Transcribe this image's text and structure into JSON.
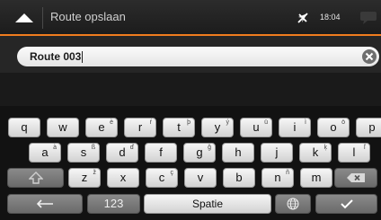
{
  "header": {
    "title": "Route opslaan",
    "time": "18:04",
    "back_icon": "chevron-up-icon",
    "gps_icon": "gps-off-icon",
    "message_icon": "message-bubble-icon"
  },
  "input": {
    "value": "Route 003",
    "clear_icon": "clear-icon"
  },
  "keyboard": {
    "row1": [
      {
        "key": "q",
        "alt": ""
      },
      {
        "key": "w",
        "alt": ""
      },
      {
        "key": "e",
        "alt": "è"
      },
      {
        "key": "r",
        "alt": "ŕ"
      },
      {
        "key": "t",
        "alt": "þ"
      },
      {
        "key": "y",
        "alt": "ý"
      },
      {
        "key": "u",
        "alt": "ü"
      },
      {
        "key": "i",
        "alt": "ì"
      },
      {
        "key": "o",
        "alt": "ö"
      },
      {
        "key": "p",
        "alt": ""
      }
    ],
    "row2": [
      {
        "key": "a",
        "alt": "à"
      },
      {
        "key": "s",
        "alt": "ß"
      },
      {
        "key": "d",
        "alt": "ď"
      },
      {
        "key": "f",
        "alt": ""
      },
      {
        "key": "g",
        "alt": "ğ"
      },
      {
        "key": "h",
        "alt": ""
      },
      {
        "key": "j",
        "alt": ""
      },
      {
        "key": "k",
        "alt": "ķ"
      },
      {
        "key": "l",
        "alt": "ľ"
      }
    ],
    "row3": [
      {
        "key": "z",
        "alt": "ž"
      },
      {
        "key": "x",
        "alt": ""
      },
      {
        "key": "c",
        "alt": "ç"
      },
      {
        "key": "v",
        "alt": ""
      },
      {
        "key": "b",
        "alt": ""
      },
      {
        "key": "n",
        "alt": "ñ"
      },
      {
        "key": "m",
        "alt": ""
      }
    ],
    "shift_icon": "shift-icon",
    "backspace_icon": "backspace-icon",
    "back_arrow_icon": "arrow-left-icon",
    "numbers_label": "123",
    "space_label": "Spatie",
    "globe_icon": "globe-icon",
    "confirm_icon": "checkmark-icon"
  },
  "colors": {
    "accent": "#f07c1e",
    "background": "#1a1a1a"
  }
}
